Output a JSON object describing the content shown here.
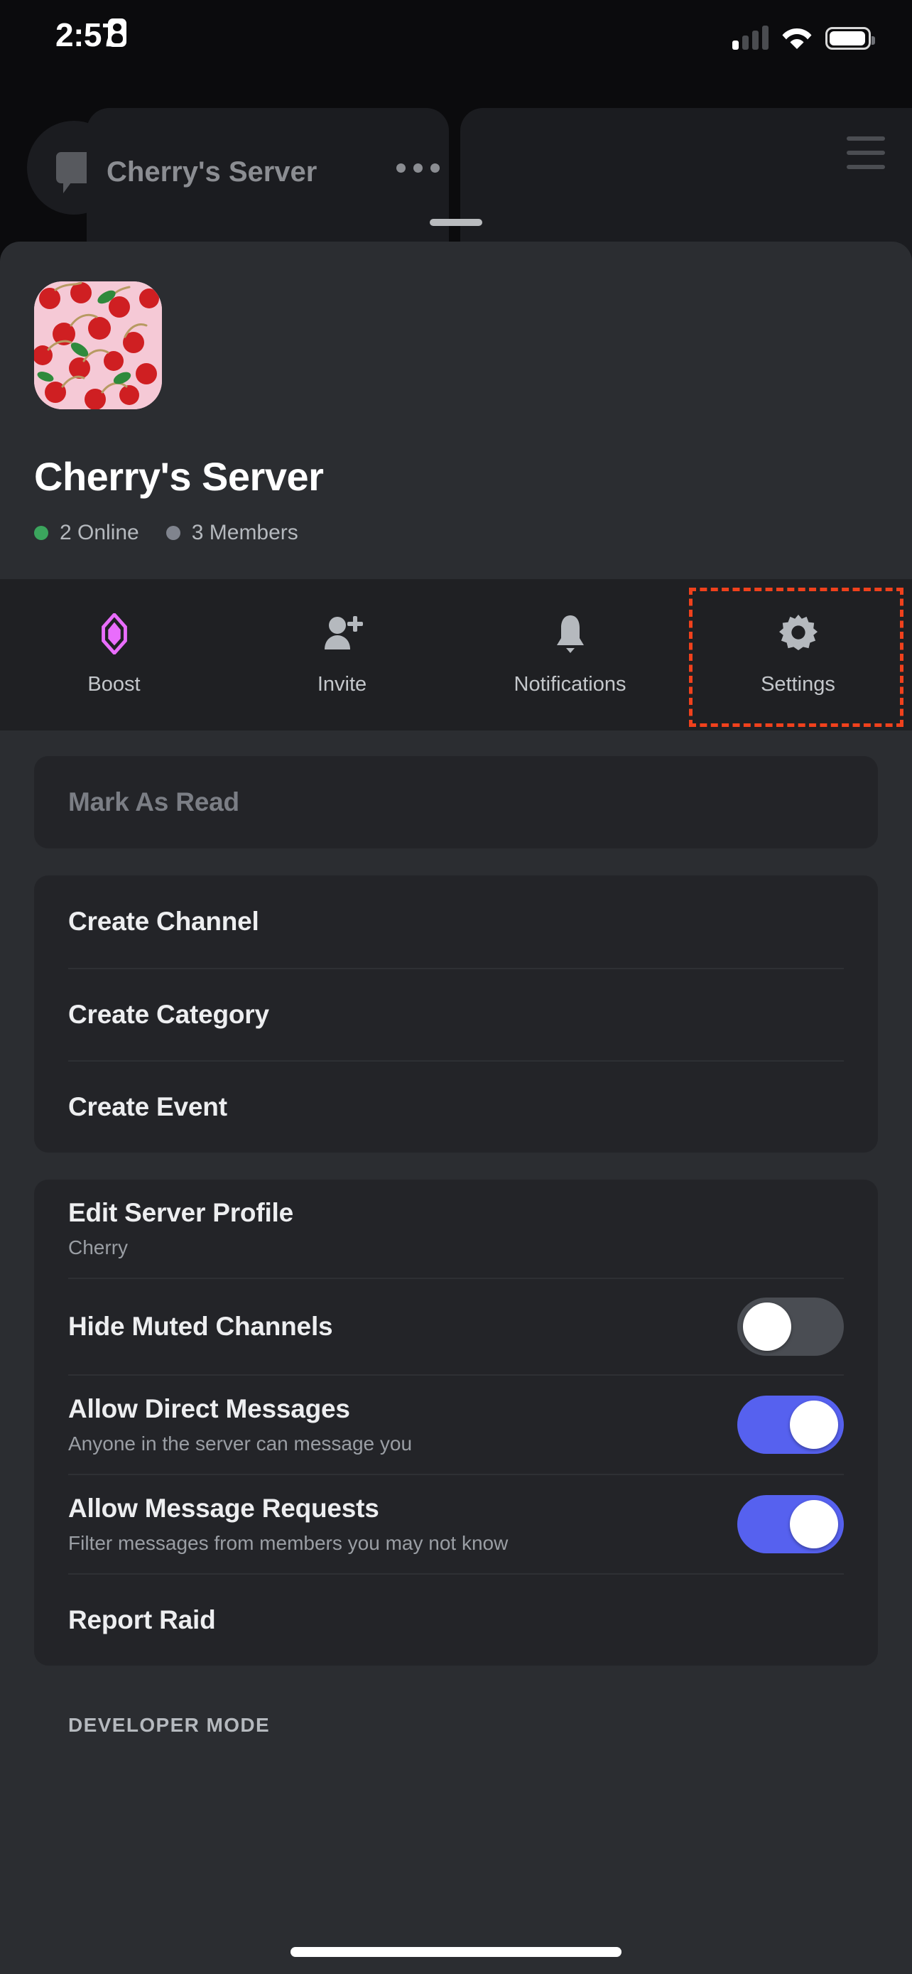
{
  "status_bar": {
    "time": "2:57",
    "recording_icon": "id-card-icon",
    "signal_icon": "cellular-signal-icon",
    "wifi_icon": "wifi-icon",
    "battery_icon": "battery-icon"
  },
  "background_app": {
    "dm_icon": "chat-bubble-icon",
    "server_title": "Cherry's Server",
    "overflow_icon": "more-options-icon",
    "menu_icon": "hamburger-menu-icon"
  },
  "sheet": {
    "avatar_icon": "server-avatar-cherries",
    "server_name": "Cherry's Server",
    "presence": {
      "online": "2 Online",
      "online_color": "#3ba55d",
      "members": "3 Members",
      "members_color": "#80848e"
    },
    "actions": [
      {
        "label": "Boost",
        "icon": "boost-diamond-icon",
        "color": "#e96dfc"
      },
      {
        "label": "Invite",
        "icon": "person-add-icon",
        "color": "#b5b9be"
      },
      {
        "label": "Notifications",
        "icon": "bell-icon",
        "color": "#b5b9be"
      },
      {
        "label": "Settings",
        "icon": "gear-icon",
        "color": "#b5b9be"
      }
    ],
    "highlight": {
      "target": "Settings",
      "color": "#f0411c"
    },
    "groups": [
      {
        "rows": [
          {
            "title": "Mark As Read",
            "style": "muted",
            "control": "none"
          }
        ]
      },
      {
        "rows": [
          {
            "title": "Create Channel",
            "control": "none"
          },
          {
            "title": "Create Category",
            "control": "none"
          },
          {
            "title": "Create Event",
            "control": "none"
          }
        ]
      },
      {
        "rows": [
          {
            "title": "Edit Server Profile",
            "subtitle": "Cherry",
            "control": "none"
          },
          {
            "title": "Hide Muted Channels",
            "control": "toggle",
            "value": "off"
          },
          {
            "title": "Allow Direct Messages",
            "subtitle": "Anyone in the server can message you",
            "control": "toggle",
            "value": "on"
          },
          {
            "title": "Allow Message Requests",
            "subtitle": "Filter messages from members you may not know",
            "control": "toggle",
            "value": "on"
          },
          {
            "title": "Report Raid",
            "control": "none"
          }
        ]
      }
    ],
    "section_label": "DEVELOPER MODE"
  },
  "colors": {
    "sheet_bg": "#2b2d31",
    "card_bg": "#232428",
    "actions_bg": "#1f2023",
    "toggle_on": "#5661ef",
    "toggle_off": "#4a4d53",
    "highlight": "#f0411c"
  }
}
